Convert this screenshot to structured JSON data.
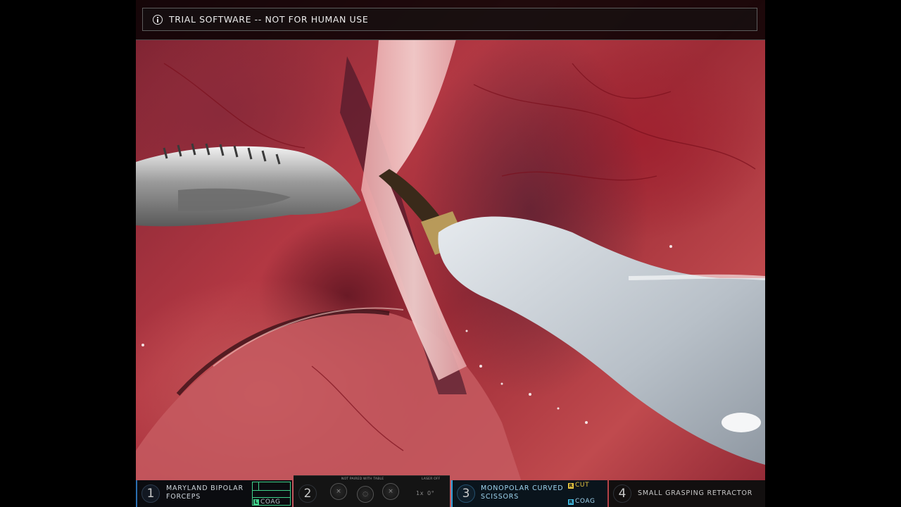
{
  "banner": {
    "text": "TRIAL SOFTWARE -- NOT FOR HUMAN USE",
    "icon": "info-icon"
  },
  "instruments": {
    "arm1": {
      "number": "1",
      "name_line1": "MARYLAND BIPOLAR",
      "name_line2": "FORCEPS",
      "pedal_key": "L",
      "pedal_label": "COAG",
      "accent": "#3fd08a"
    },
    "arm2": {
      "number": "2",
      "status_top": "NOT PAIRED WITH TABLE",
      "laser": "LASER OFF",
      "zoom": "1x",
      "angle": "0°"
    },
    "arm3": {
      "number": "3",
      "name_line1": "MONOPOLAR CURVED",
      "name_line2": "SCISSORS",
      "cut_key": "R",
      "cut_label": "CUT",
      "coag_key": "R",
      "coag_label": "COAG",
      "cut_color": "#e8c640",
      "coag_color": "#3fb8e0",
      "accent": "#2f9fd8"
    },
    "arm4": {
      "number": "4",
      "name": "SMALL GRASPING RETRACTOR"
    }
  }
}
